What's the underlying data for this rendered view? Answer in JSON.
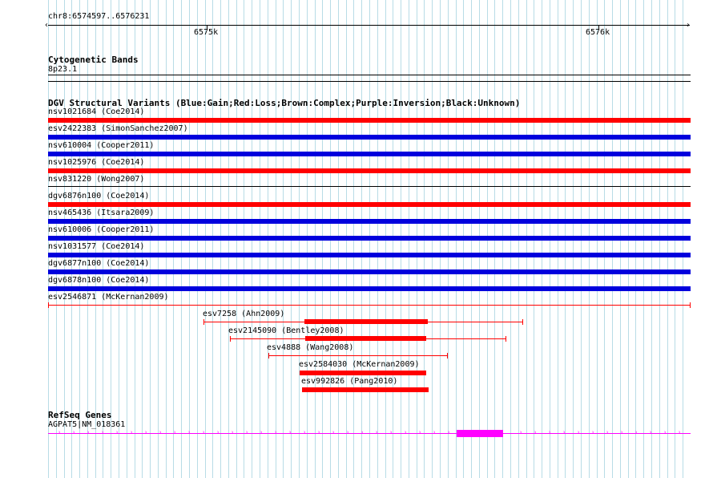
{
  "ruler": {
    "label": "chr8:6574597..6576231",
    "tick_labels": [
      "6575k",
      "6576k"
    ]
  },
  "tracks": {
    "cytoband": {
      "title": "Cytogenetic Bands",
      "band_label": "8p23.1"
    },
    "dgv": {
      "title": "DGV Structural Variants (Blue:Gain;Red:Loss;Brown:Complex;Purple:Inversion;Black:Unknown)",
      "full_span_features": [
        {
          "label": "nsv1021684 (Coe2014)",
          "color": "#ff0000"
        },
        {
          "label": "esv2422383 (SimonSanchez2007)",
          "color": "#0000dd"
        },
        {
          "label": "nsv610004 (Cooper2011)",
          "color": "#0000dd"
        },
        {
          "label": "nsv1025976 (Coe2014)",
          "color": "#ff0000"
        },
        {
          "label": "nsv831220 (Wong2007)",
          "color": "#000000"
        },
        {
          "label": "dgv6876n100 (Coe2014)",
          "color": "#ff0000"
        },
        {
          "label": "nsv465436 (Itsara2009)",
          "color": "#0000dd"
        },
        {
          "label": "nsv610006 (Cooper2011)",
          "color": "#0000dd"
        },
        {
          "label": "nsv1031577 (Coe2014)",
          "color": "#0000dd"
        },
        {
          "label": "dgv6877n100 (Coe2014)",
          "color": "#0000dd"
        },
        {
          "label": "dgv6878n100 (Coe2014)",
          "color": "#0000dd"
        },
        {
          "label": "esv2546871 (McKernan2009)",
          "color": "#ff0000"
        }
      ],
      "partial_features": [
        {
          "label": "esv7258 (Ahn2009)",
          "color": "#ff0000"
        },
        {
          "label": "esv2145090 (Bentley2008)",
          "color": "#ff0000"
        },
        {
          "label": "esv4888 (Wang2008)",
          "color": "#ff0000"
        },
        {
          "label": "esv2584030 (McKernan2009)",
          "color": "#ff0000"
        },
        {
          "label": "esv992826 (Pang2010)",
          "color": "#ff0000"
        }
      ]
    },
    "refseq": {
      "title": "RefSeq Genes",
      "gene_label": "AGPAT5|NM_018361",
      "color": "#ff00ff"
    }
  },
  "colors": {
    "grid": "#b8dce6",
    "gain": "#0000dd",
    "loss": "#ff0000",
    "gene": "#ff00ff"
  }
}
